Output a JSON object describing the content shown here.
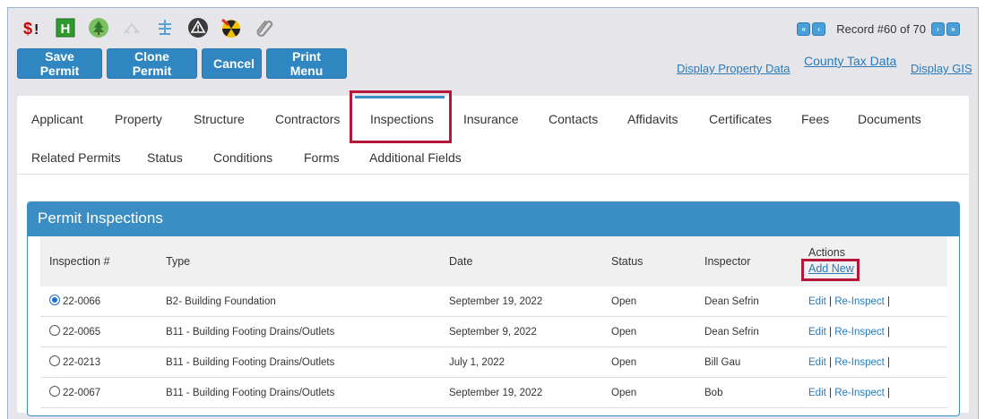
{
  "toolbar_icons": [
    {
      "name": "dollar-alert-icon",
      "color": "#cc0000"
    },
    {
      "name": "h-badge-icon",
      "color": "#3aa63a"
    },
    {
      "name": "tree-icon",
      "color": "#6bb35a"
    },
    {
      "name": "snowflake-icon",
      "color": "#bbbbbb"
    },
    {
      "name": "water-icon",
      "color": "#5aa0d8"
    },
    {
      "name": "warning-icon",
      "color": "#444444"
    },
    {
      "name": "hazard-icon",
      "color": "#e8b800"
    },
    {
      "name": "paperclip-icon",
      "color": "#999999"
    }
  ],
  "buttons": {
    "save": "Save Permit",
    "clone": "Clone Permit",
    "cancel": "Cancel",
    "print": "Print Menu"
  },
  "record": {
    "text": "Record #60 of 70"
  },
  "links": {
    "display_property": "Display Property Data",
    "county_tax": "County Tax Data",
    "display_gis": "Display GIS"
  },
  "tabs": {
    "row1": [
      "Applicant",
      "Property",
      "Structure",
      "Contractors",
      "Inspections",
      "Insurance",
      "Contacts",
      "Affidavits",
      "Certificates",
      "Fees",
      "Documents"
    ],
    "row2": [
      "Related Permits",
      "Status",
      "Conditions",
      "Forms",
      "Additional Fields"
    ],
    "active": "Inspections"
  },
  "inspections": {
    "title": "Permit Inspections",
    "headers": {
      "number": "Inspection #",
      "type": "Type",
      "date": "Date",
      "status": "Status",
      "inspector": "Inspector",
      "actions": "Actions",
      "add_new": "Add New"
    },
    "rows": [
      {
        "number": "22-0066",
        "type": "B2- Building Foundation",
        "date": "September 19, 2022",
        "status": "Open",
        "inspector": "Dean Sefrin",
        "selected": true
      },
      {
        "number": "22-0065",
        "type": "B11 - Building Footing Drains/Outlets",
        "date": "September 9, 2022",
        "status": "Open",
        "inspector": "Dean Sefrin",
        "selected": false
      },
      {
        "number": "22-0213",
        "type": "B11 - Building Footing Drains/Outlets",
        "date": "July 1, 2022",
        "status": "Open",
        "inspector": "Bill Gau",
        "selected": false
      },
      {
        "number": "22-0067",
        "type": "B11 - Building Footing Drains/Outlets",
        "date": "September 19, 2022",
        "status": "Open",
        "inspector": "Bob",
        "selected": false
      }
    ],
    "action_labels": {
      "edit": "Edit",
      "reinspect": "Re-Inspect",
      "sep": "|"
    }
  }
}
